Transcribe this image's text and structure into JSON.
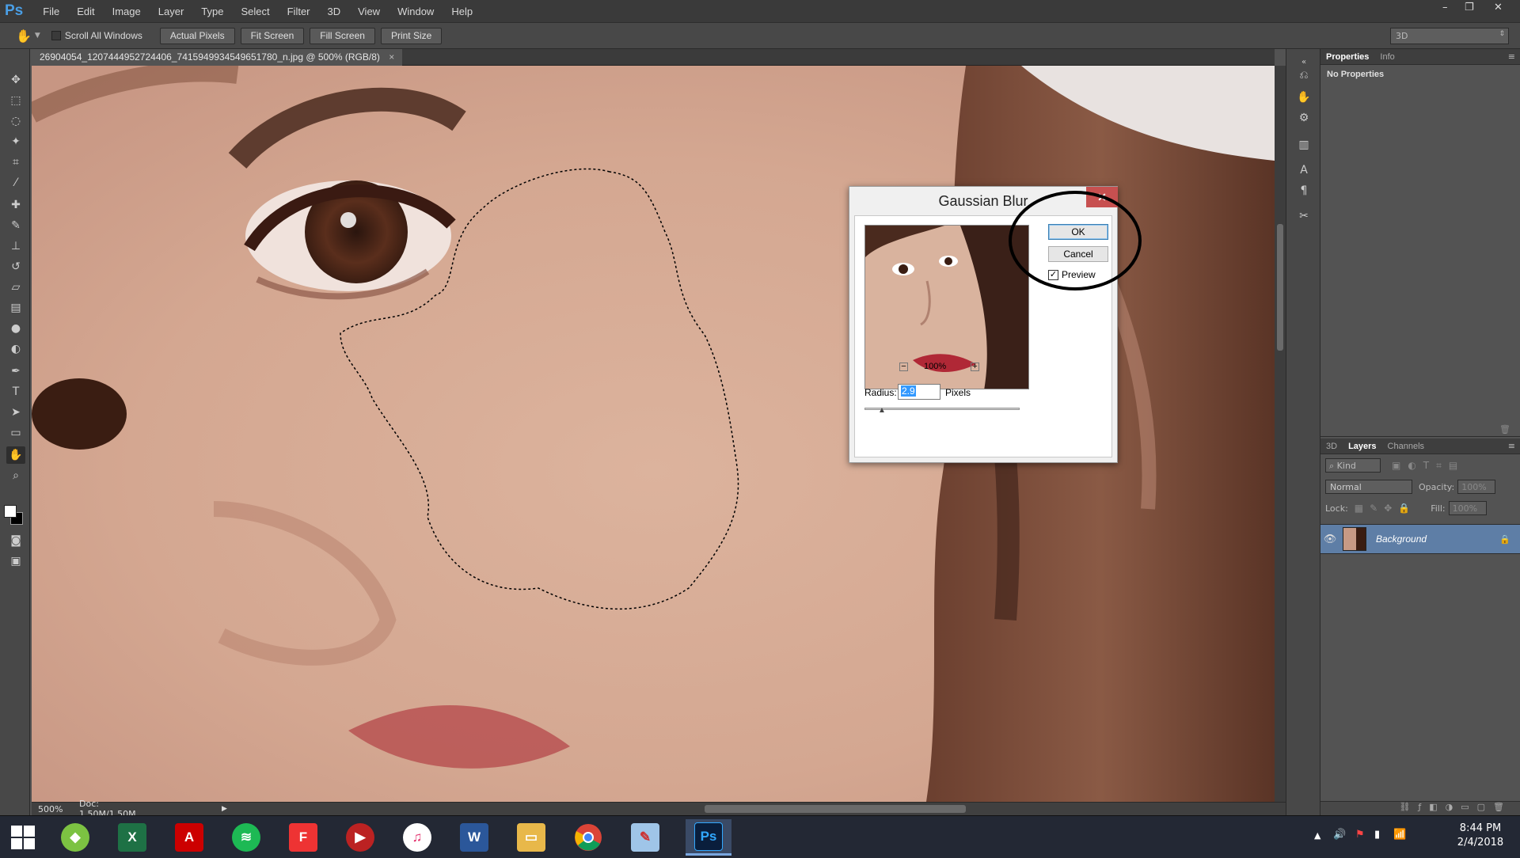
{
  "menubar": {
    "logo": "Ps",
    "items": [
      "File",
      "Edit",
      "Image",
      "Layer",
      "Type",
      "Select",
      "Filter",
      "3D",
      "View",
      "Window",
      "Help"
    ]
  },
  "options": {
    "scroll_all_windows": "Scroll All Windows",
    "actual_pixels": "Actual Pixels",
    "fit_screen": "Fit Screen",
    "fill_screen": "Fill Screen",
    "print_size": "Print Size",
    "workspace": "3D"
  },
  "document": {
    "tab_title": "26904054_1207444952724406_7415949934549651780_n.jpg @ 500% (RGB/8)",
    "close": "×"
  },
  "status": {
    "zoom": "500%",
    "doc": "Doc: 1.50M/1.50M"
  },
  "properties_panel": {
    "tabs": [
      "Properties",
      "Info"
    ],
    "content": "No Properties"
  },
  "layers_panel": {
    "tabs": [
      "3D",
      "Layers",
      "Channels"
    ],
    "kind": "Kind",
    "blend_mode": "Normal",
    "opacity_label": "Opacity:",
    "opacity_value": "100%",
    "lock_label": "Lock:",
    "fill_label": "Fill:",
    "fill_value": "100%",
    "layers": [
      {
        "name": "Background",
        "visible": true,
        "locked": true
      }
    ]
  },
  "dialog": {
    "title": "Gaussian Blur",
    "ok": "OK",
    "cancel": "Cancel",
    "preview_label": "Preview",
    "preview_checked": true,
    "zoom": "100%",
    "zoom_out": "−",
    "zoom_in": "+",
    "radius_label": "Radius:",
    "radius_value": "2.9",
    "radius_unit": "Pixels"
  },
  "taskbar": {
    "apps": [
      "start",
      "maps",
      "excel",
      "acrobat",
      "spotify",
      "foxit",
      "media",
      "itunes",
      "word",
      "explorer",
      "chrome",
      "paint",
      "photoshop"
    ],
    "time": "8:44 PM",
    "date": "2/4/2018"
  }
}
